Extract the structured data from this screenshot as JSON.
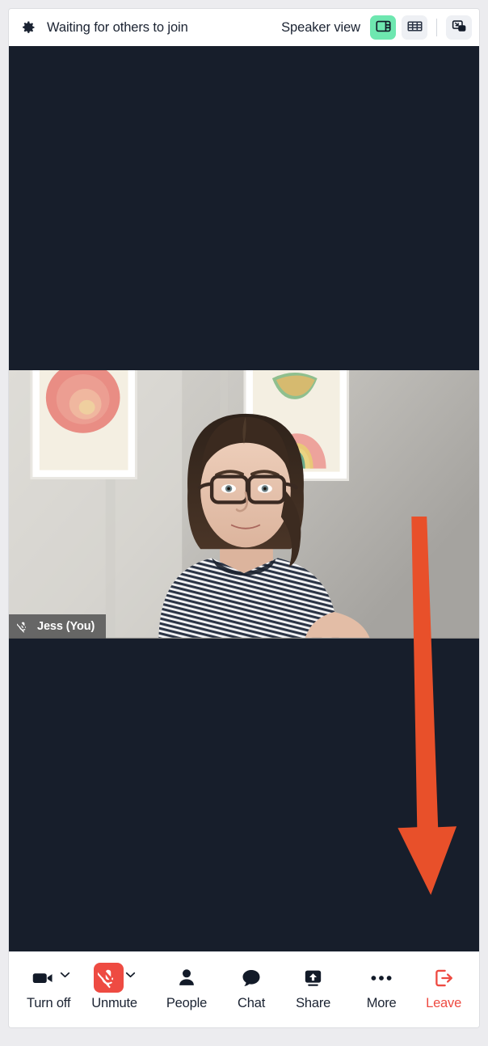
{
  "header": {
    "gear_icon": "gear-icon",
    "title": "Waiting for others to join",
    "view_mode_label": "Speaker view",
    "buttons": [
      {
        "name": "speaker-view-toggle",
        "icon": "speaker-view-icon",
        "active": true
      },
      {
        "name": "grid-view-toggle",
        "icon": "grid-view-icon",
        "active": false
      },
      {
        "name": "picture-in-picture-toggle",
        "icon": "picture-in-picture-icon",
        "active": false
      }
    ]
  },
  "stage": {
    "background_color": "#171E2B",
    "participant": {
      "name": "Jess (You)",
      "muted": true,
      "mic_icon": "mic-off-icon"
    }
  },
  "annotation": {
    "type": "arrow",
    "color": "#E8502A",
    "direction": "down",
    "points_to": "leave-button"
  },
  "toolbar": {
    "items": [
      {
        "name": "camera-button",
        "icon": "video-camera-icon",
        "label": "Turn off",
        "has_caret": true,
        "alert": false
      },
      {
        "name": "mic-button",
        "icon": "mic-off-icon",
        "label": "Unmute",
        "has_caret": true,
        "alert": true
      },
      {
        "name": "people-button",
        "icon": "person-icon",
        "label": "People",
        "has_caret": false,
        "alert": false
      },
      {
        "name": "chat-button",
        "icon": "chat-bubble-icon",
        "label": "Chat",
        "has_caret": false,
        "alert": false
      },
      {
        "name": "share-button",
        "icon": "share-screen-icon",
        "label": "Share",
        "has_caret": false,
        "alert": false
      },
      {
        "name": "more-button",
        "icon": "ellipsis-icon",
        "label": "More",
        "has_caret": false,
        "alert": false
      },
      {
        "name": "leave-button",
        "icon": "leave-icon",
        "label": "Leave",
        "has_caret": false,
        "alert": false,
        "danger": true
      }
    ]
  },
  "colors": {
    "accent_green": "#6EE7B0",
    "danger_red": "#EE4B42",
    "stage_dark": "#171E2B",
    "annotation_orange": "#E8502A"
  }
}
